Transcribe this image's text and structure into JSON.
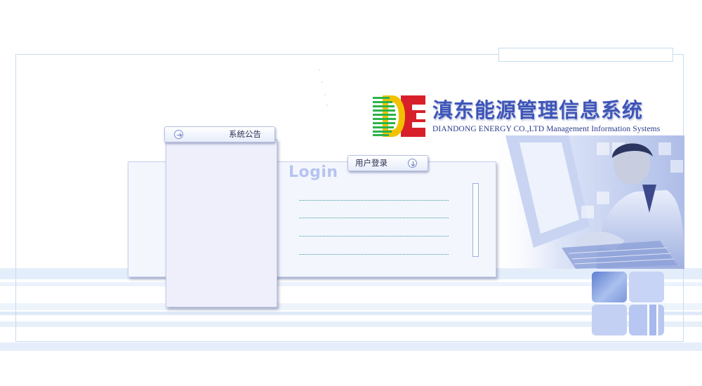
{
  "header": {
    "title": "滇东能源管理信息系统",
    "subtitle": "DIANDONG  ENERGY CO.,LTD Management Information Systems",
    "logo_text": "DE"
  },
  "notice": {
    "tab_label": "系统公告",
    "icon": "arrow-right-circle-icon"
  },
  "login": {
    "tab_label": "用户登录",
    "icon": "arrow-down-circle-icon",
    "heading": "Login",
    "fields": [
      "",
      "",
      "",
      ""
    ]
  },
  "colors": {
    "title": "#3e55b8",
    "logo_green": "#2db34a",
    "logo_yellow": "#f2c200",
    "logo_red": "#d8202a",
    "panel_bg": "#f4f6fe",
    "band": "#e4eefb"
  }
}
